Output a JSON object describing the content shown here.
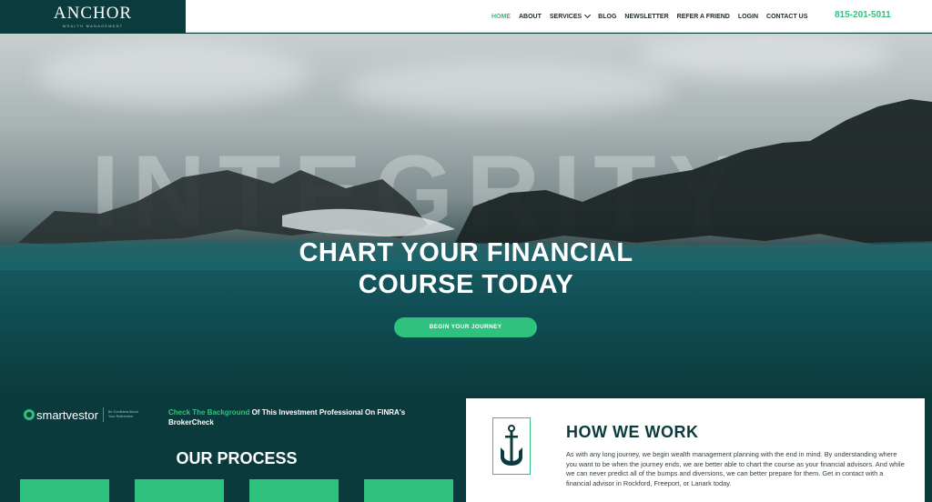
{
  "header": {
    "logo": "ANCHOR",
    "logo_sub": "WEALTH MANAGEMENT",
    "phone": "815-201-5011",
    "nav": [
      {
        "label": "HOME",
        "active": true
      },
      {
        "label": "ABOUT"
      },
      {
        "label": "SERVICES",
        "dropdown": true
      },
      {
        "label": "BLOG"
      },
      {
        "label": "NEWSLETTER"
      },
      {
        "label": "REFER A FRIEND"
      },
      {
        "label": "LOGIN"
      },
      {
        "label": "CONTACT US"
      }
    ]
  },
  "hero": {
    "background_word": "INTEGRITY",
    "title_line1": "CHART YOUR FINANCIAL",
    "title_line2": "COURSE TODAY",
    "button": "BEGIN YOUR JOURNEY"
  },
  "smartvestor": {
    "name": "smartvestor",
    "tagline": "Be Confident About Your Retirement"
  },
  "brokercheck": {
    "link": "Check The Background",
    "text": " Of This Investment Professional On FINRA's BrokerCheck"
  },
  "process": {
    "title": "OUR PROCESS"
  },
  "how_we_work": {
    "title": "HOW WE WORK",
    "body": "As with any long journey, we begin wealth management planning with the end in mind. By understanding where you want to be when the journey ends, we are better able to chart the course as your financial advisors. And while we can never predict all of the bumps and diversions, we can better prepare for them. Get in contact with a financial advisor in Rockford, Freeport, or Lanark today."
  },
  "colors": {
    "accent": "#2ec27e",
    "dark_teal": "#0c3b3e"
  }
}
